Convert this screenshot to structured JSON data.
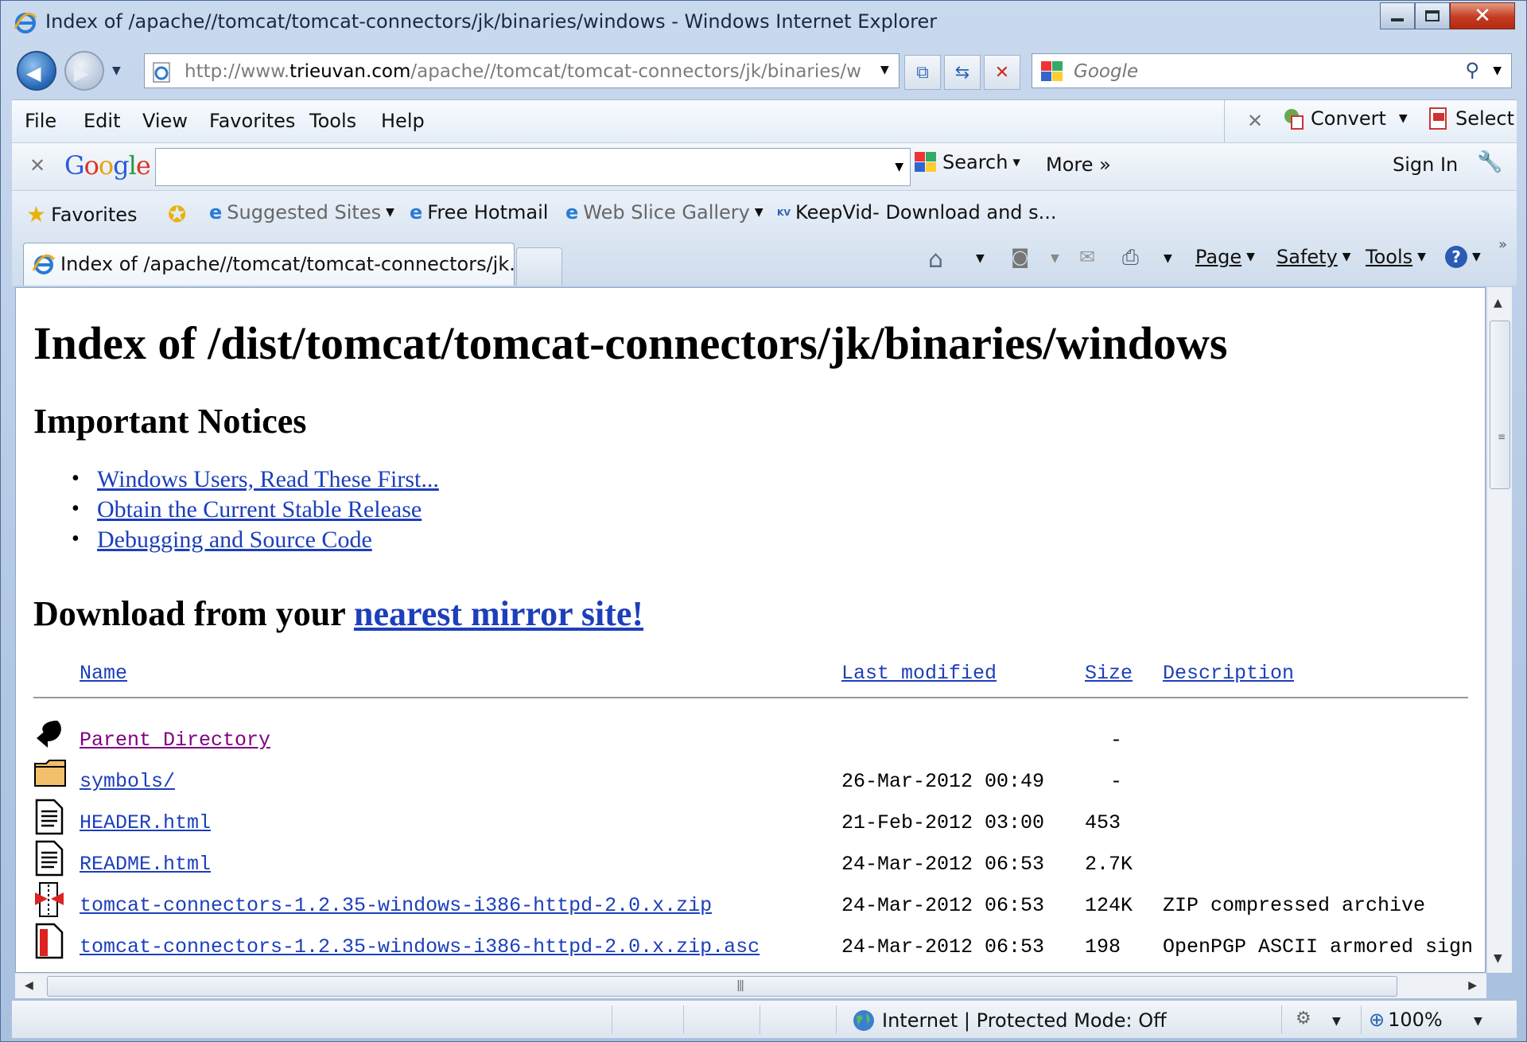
{
  "window": {
    "title": "Index of /apache//tomcat/tomcat-connectors/jk/binaries/windows - Windows Internet Explorer"
  },
  "address": {
    "url_prefix": "http://www.",
    "url_domain": "trieuvan.com",
    "url_path": "/apache//tomcat/tomcat-connectors/jk/binaries/wind"
  },
  "search_box": {
    "placeholder": "Google"
  },
  "menu": [
    "File",
    "Edit",
    "View",
    "Favorites",
    "Tools",
    "Help"
  ],
  "menu_right": {
    "convert": "Convert",
    "select": "Select"
  },
  "google_toolbar": {
    "logo": "Google",
    "search_label": "Search",
    "more_label": "More »",
    "sign_in": "Sign In"
  },
  "favorites_bar": {
    "favorites": "Favorites",
    "suggested": "Suggested Sites",
    "hotmail": "Free Hotmail",
    "webslice": "Web Slice Gallery",
    "keepvid": "KeepVid- Download and s..."
  },
  "tabs": {
    "active": "Index of /apache//tomcat/tomcat-connectors/jk...",
    "commands": {
      "page": "Page",
      "safety": "Safety",
      "tools": "Tools"
    }
  },
  "page": {
    "heading": "Index of /dist/tomcat/tomcat-connectors/jk/binaries/windows",
    "notices_heading": "Important Notices",
    "notices": [
      "Windows Users, Read These First...",
      "Obtain the Current Stable Release",
      "Debugging and Source Code"
    ],
    "download_prefix": "Download from your ",
    "download_link": "nearest mirror site!",
    "columns": {
      "name": "Name",
      "modified": "Last modified",
      "size": "Size",
      "description": "Description"
    },
    "rows": [
      {
        "icon": "back-icon",
        "name": "Parent Directory",
        "modified": "",
        "size": "-",
        "description": "",
        "visited": true
      },
      {
        "icon": "folder-icon",
        "name": "symbols/",
        "modified": "26-Mar-2012 00:49",
        "size": "-",
        "description": ""
      },
      {
        "icon": "text-file-icon",
        "name": "HEADER.html",
        "modified": "21-Feb-2012 03:00",
        "size": "453",
        "description": ""
      },
      {
        "icon": "text-file-icon",
        "name": "README.html",
        "modified": "24-Mar-2012 06:53",
        "size": "2.7K",
        "description": ""
      },
      {
        "icon": "zip-file-icon",
        "name": "tomcat-connectors-1.2.35-windows-i386-httpd-2.0.x.zip",
        "modified": "24-Mar-2012 06:53",
        "size": "124K",
        "description": "ZIP compressed archive"
      },
      {
        "icon": "signature-file-icon",
        "name": "tomcat-connectors-1.2.35-windows-i386-httpd-2.0.x.zip.asc",
        "modified": "24-Mar-2012 06:53",
        "size": "198",
        "description": "OpenPGP ASCII armored sign"
      }
    ]
  },
  "status_bar": {
    "zone": "Internet | Protected Mode: Off",
    "zoom": "100%"
  }
}
